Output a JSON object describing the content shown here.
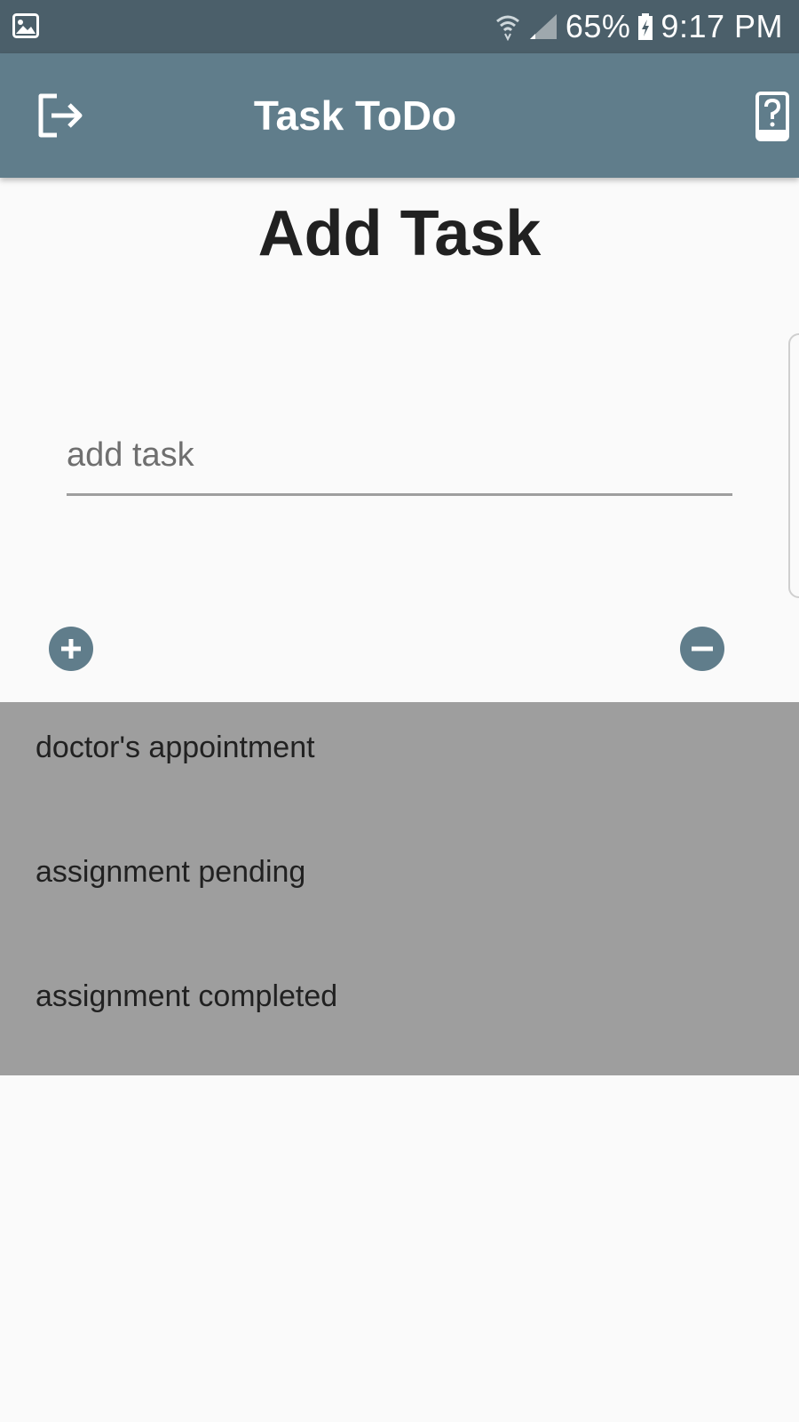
{
  "status_bar": {
    "battery": "65%",
    "time": "9:17 PM",
    "icons": [
      "image-icon",
      "wifi-icon",
      "signal-icon",
      "battery-charging-icon"
    ]
  },
  "app_bar": {
    "title": "Task ToDo",
    "left_icon": "logout-icon",
    "right_icon": "help-icon",
    "color": "#607D8B"
  },
  "main": {
    "heading": "Add Task",
    "input": {
      "placeholder": "add task",
      "value": ""
    },
    "add_icon": "plus-circle-icon",
    "remove_icon": "minus-circle-icon",
    "tasks": [
      "doctor's appointment",
      "assignment pending",
      "assignment completed"
    ]
  },
  "colors": {
    "status_bar": "#4B5F6A",
    "primary": "#607D8B",
    "list_background": "#9E9E9E",
    "page_background": "#FAFAFA"
  }
}
